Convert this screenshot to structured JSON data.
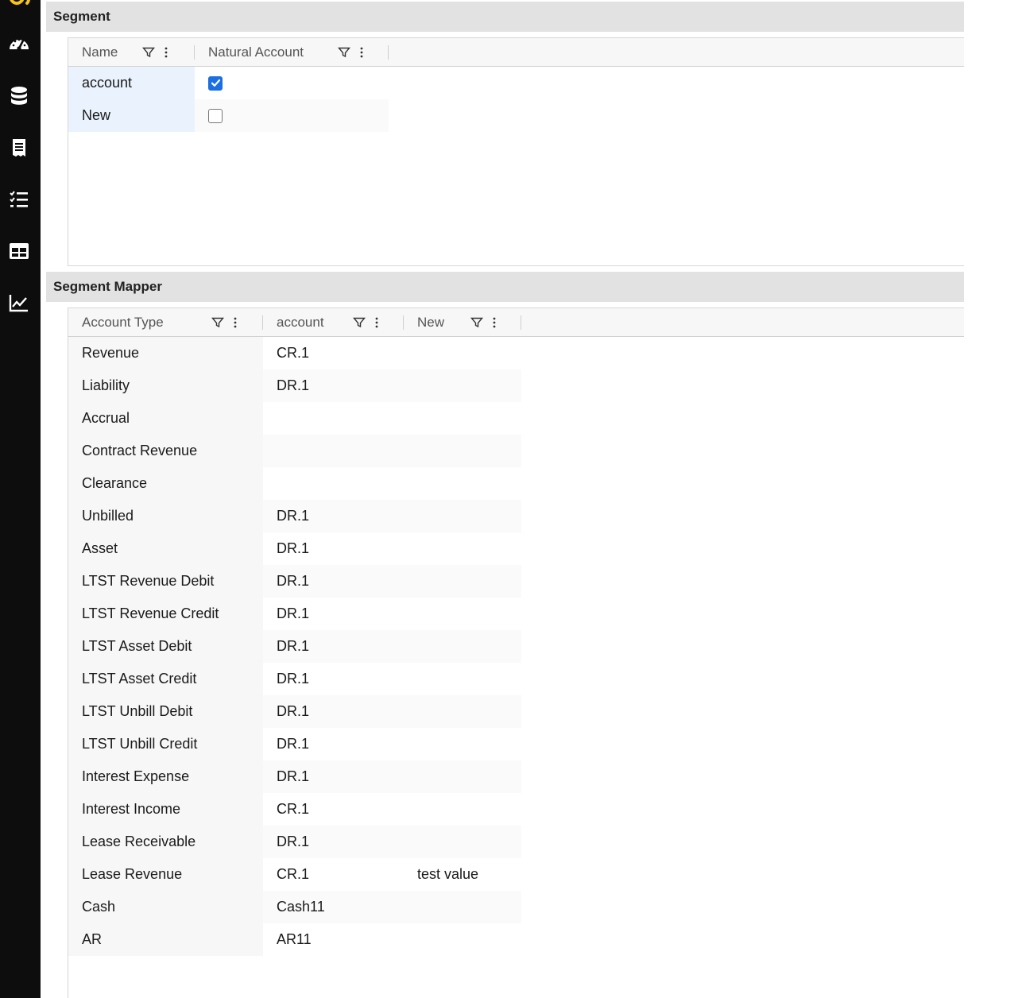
{
  "sidebar": {
    "icons": [
      "logo-icon",
      "dashboard-gauge-icon",
      "database-icon",
      "receipt-icon",
      "checklist-icon",
      "table-grid-icon",
      "line-chart-icon"
    ]
  },
  "segment": {
    "title": "Segment",
    "columns": [
      "Name",
      "Natural Account"
    ],
    "rows": [
      {
        "name": "account",
        "natural": true
      },
      {
        "name": "New",
        "natural": false
      }
    ]
  },
  "mapper": {
    "title": "Segment Mapper",
    "columns": [
      "Account Type",
      "account",
      "New"
    ],
    "rows": [
      {
        "type": "Revenue",
        "account": "CR.1",
        "new": ""
      },
      {
        "type": "Liability",
        "account": "DR.1",
        "new": ""
      },
      {
        "type": "Accrual",
        "account": "",
        "new": ""
      },
      {
        "type": "Contract Revenue",
        "account": "",
        "new": ""
      },
      {
        "type": "Clearance",
        "account": "",
        "new": ""
      },
      {
        "type": "Unbilled",
        "account": "DR.1",
        "new": ""
      },
      {
        "type": "Asset",
        "account": "DR.1",
        "new": ""
      },
      {
        "type": "LTST Revenue Debit",
        "account": "DR.1",
        "new": ""
      },
      {
        "type": "LTST Revenue Credit",
        "account": "DR.1",
        "new": ""
      },
      {
        "type": "LTST Asset Debit",
        "account": "DR.1",
        "new": ""
      },
      {
        "type": "LTST Asset Credit",
        "account": "DR.1",
        "new": ""
      },
      {
        "type": "LTST Unbill Debit",
        "account": "DR.1",
        "new": ""
      },
      {
        "type": "LTST Unbill Credit",
        "account": "DR.1",
        "new": ""
      },
      {
        "type": "Interest Expense",
        "account": "DR.1",
        "new": ""
      },
      {
        "type": "Interest Income",
        "account": "CR.1",
        "new": ""
      },
      {
        "type": "Lease Receivable",
        "account": "DR.1",
        "new": ""
      },
      {
        "type": "Lease Revenue",
        "account": "CR.1",
        "new": "test value"
      },
      {
        "type": "Cash",
        "account": "Cash11",
        "new": ""
      },
      {
        "type": "AR",
        "account": "AR11",
        "new": ""
      }
    ]
  },
  "colors": {
    "sidebar_bg": "#0d0d0d",
    "logo_accent": "#f5c518",
    "checkbox_checked": "#1c6fe0",
    "section_header_bg": "#e2e2e2"
  }
}
